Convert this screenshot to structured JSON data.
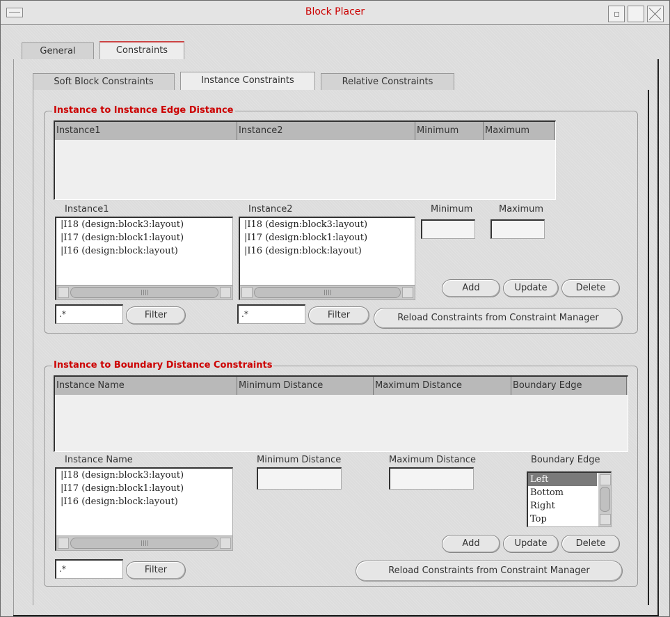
{
  "window": {
    "title": "Block Placer"
  },
  "tabs": [
    {
      "label": "General"
    },
    {
      "label": "Constraints"
    }
  ],
  "subtabs": [
    {
      "label": "Soft Block Constraints"
    },
    {
      "label": "Instance Constraints"
    },
    {
      "label": "Relative Constraints"
    }
  ],
  "edge_group": {
    "title": "Instance to Instance Edge Distance",
    "columns": [
      "Instance1",
      "Instance2",
      "Minimum",
      "Maximum"
    ],
    "instance1_label": "Instance1",
    "instance2_label": "Instance2",
    "minimum_label": "Minimum",
    "maximum_label": "Maximum",
    "instance1_items": [
      "|I18 (design:block3:layout)",
      "|I17 (design:block1:layout)",
      "|I16 (design:block:layout)"
    ],
    "instance2_items": [
      "|I18 (design:block3:layout)",
      "|I17 (design:block1:layout)",
      "|I16 (design:block:layout)"
    ],
    "minimum_value": "",
    "maximum_value": "",
    "filter1_value": ".*",
    "filter2_value": ".*",
    "filter_label": "Filter",
    "add_label": "Add",
    "update_label": "Update",
    "delete_label": "Delete",
    "reload_label": "Reload Constraints from Constraint Manager"
  },
  "boundary_group": {
    "title": "Instance to Boundary Distance Constraints",
    "columns": [
      "Instance Name",
      "Minimum Distance",
      "Maximum Distance",
      "Boundary Edge"
    ],
    "instance_label": "Instance Name",
    "min_label": "Minimum Distance",
    "max_label": "Maximum Distance",
    "edge_label": "Boundary Edge",
    "instance_items": [
      "|I18 (design:block3:layout)",
      "|I17 (design:block1:layout)",
      "|I16 (design:block:layout)"
    ],
    "edge_options": [
      "Left",
      "Bottom",
      "Right",
      "Top"
    ],
    "edge_selected": "Left",
    "min_value": "",
    "max_value": "",
    "filter_value": ".*",
    "filter_label": "Filter",
    "add_label": "Add",
    "update_label": "Update",
    "delete_label": "Delete",
    "reload_label": "Reload Constraints from Constraint Manager"
  }
}
